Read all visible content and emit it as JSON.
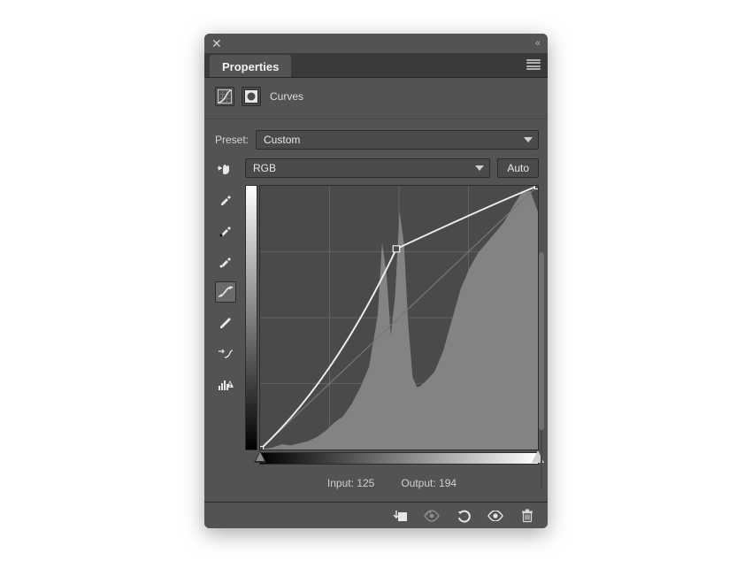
{
  "panel": {
    "title": "Properties",
    "adjustment_name": "Curves"
  },
  "preset": {
    "label": "Preset:",
    "value": "Custom",
    "options": [
      "Custom"
    ]
  },
  "channel": {
    "value": "RGB",
    "options": [
      "RGB"
    ],
    "auto_label": "Auto"
  },
  "io": {
    "input_label": "Input:",
    "input_value": "125",
    "output_label": "Output:",
    "output_value": "194"
  },
  "colors": {
    "panel_bg": "#535353",
    "panel_dark": "#3a3a3a",
    "border": "#2c2c2c",
    "text": "#e8e8e8"
  },
  "tools": [
    {
      "name": "eyedropper-icon",
      "active": false
    },
    {
      "name": "eyedropper-black-icon",
      "active": false
    },
    {
      "name": "eyedropper-white-icon",
      "active": false
    },
    {
      "name": "curve-point-icon",
      "active": true
    },
    {
      "name": "pencil-icon",
      "active": false
    },
    {
      "name": "smooth-icon",
      "active": false
    },
    {
      "name": "histogram-warning-icon",
      "active": false
    }
  ],
  "chart_data": {
    "type": "line",
    "title": "Curves",
    "xlabel": "Input",
    "ylabel": "Output",
    "xlim": [
      0,
      255
    ],
    "ylim": [
      0,
      255
    ],
    "series": [
      {
        "name": "baseline",
        "x": [
          0,
          255
        ],
        "y": [
          0,
          255
        ]
      },
      {
        "name": "curve",
        "control_points": [
          {
            "x": 0,
            "y": 0
          },
          {
            "x": 125,
            "y": 194
          },
          {
            "x": 255,
            "y": 255
          }
        ]
      }
    ],
    "histogram_approx": {
      "x": [
        0,
        12,
        20,
        28,
        36,
        44,
        52,
        60,
        68,
        76,
        84,
        92,
        100,
        108,
        112,
        116,
        120,
        124,
        128,
        132,
        136,
        140,
        144,
        148,
        152,
        160,
        168,
        176,
        184,
        192,
        200,
        208,
        216,
        224,
        232,
        240,
        248,
        255
      ],
      "y": [
        0,
        2,
        5,
        4,
        6,
        8,
        12,
        18,
        26,
        32,
        44,
        60,
        80,
        130,
        200,
        170,
        110,
        150,
        230,
        200,
        120,
        70,
        60,
        62,
        66,
        75,
        95,
        125,
        155,
        175,
        190,
        200,
        210,
        220,
        235,
        248,
        250,
        230
      ]
    }
  }
}
